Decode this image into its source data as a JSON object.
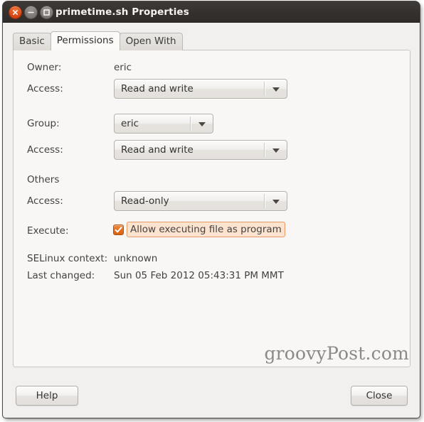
{
  "window": {
    "title": "primetime.sh Properties",
    "controls": [
      {
        "name": "close",
        "glyph": "x"
      },
      {
        "name": "minimize",
        "glyph": "-"
      },
      {
        "name": "maximize",
        "glyph": "square"
      }
    ],
    "accent_color": "#dd4814",
    "titlebar_color": "#35312e"
  },
  "tabs": [
    {
      "label": "Basic",
      "active": false
    },
    {
      "label": "Permissions",
      "active": true
    },
    {
      "label": "Open With",
      "active": false
    }
  ],
  "permissions": {
    "owner_label": "Owner:",
    "owner_value": "eric",
    "owner_access_label": "Access:",
    "owner_access_value": "Read and write",
    "group_label": "Group:",
    "group_value": "eric",
    "group_access_label": "Access:",
    "group_access_value": "Read and write",
    "others_label": "Others",
    "others_access_label": "Access:",
    "others_access_value": "Read-only",
    "execute_label": "Execute:",
    "execute_checkbox_text": "Allow executing file as program",
    "execute_checked": true,
    "execute_highlight_color": "#e79a63",
    "selinux_label": "SELinux context:",
    "selinux_value": "unknown",
    "last_changed_label": "Last changed:",
    "last_changed_value": "Sun 05 Feb 2012 05:43:31 PM MMT"
  },
  "watermark": "groovyPost.com",
  "footer": {
    "help_label": "Help",
    "close_label": "Close"
  }
}
